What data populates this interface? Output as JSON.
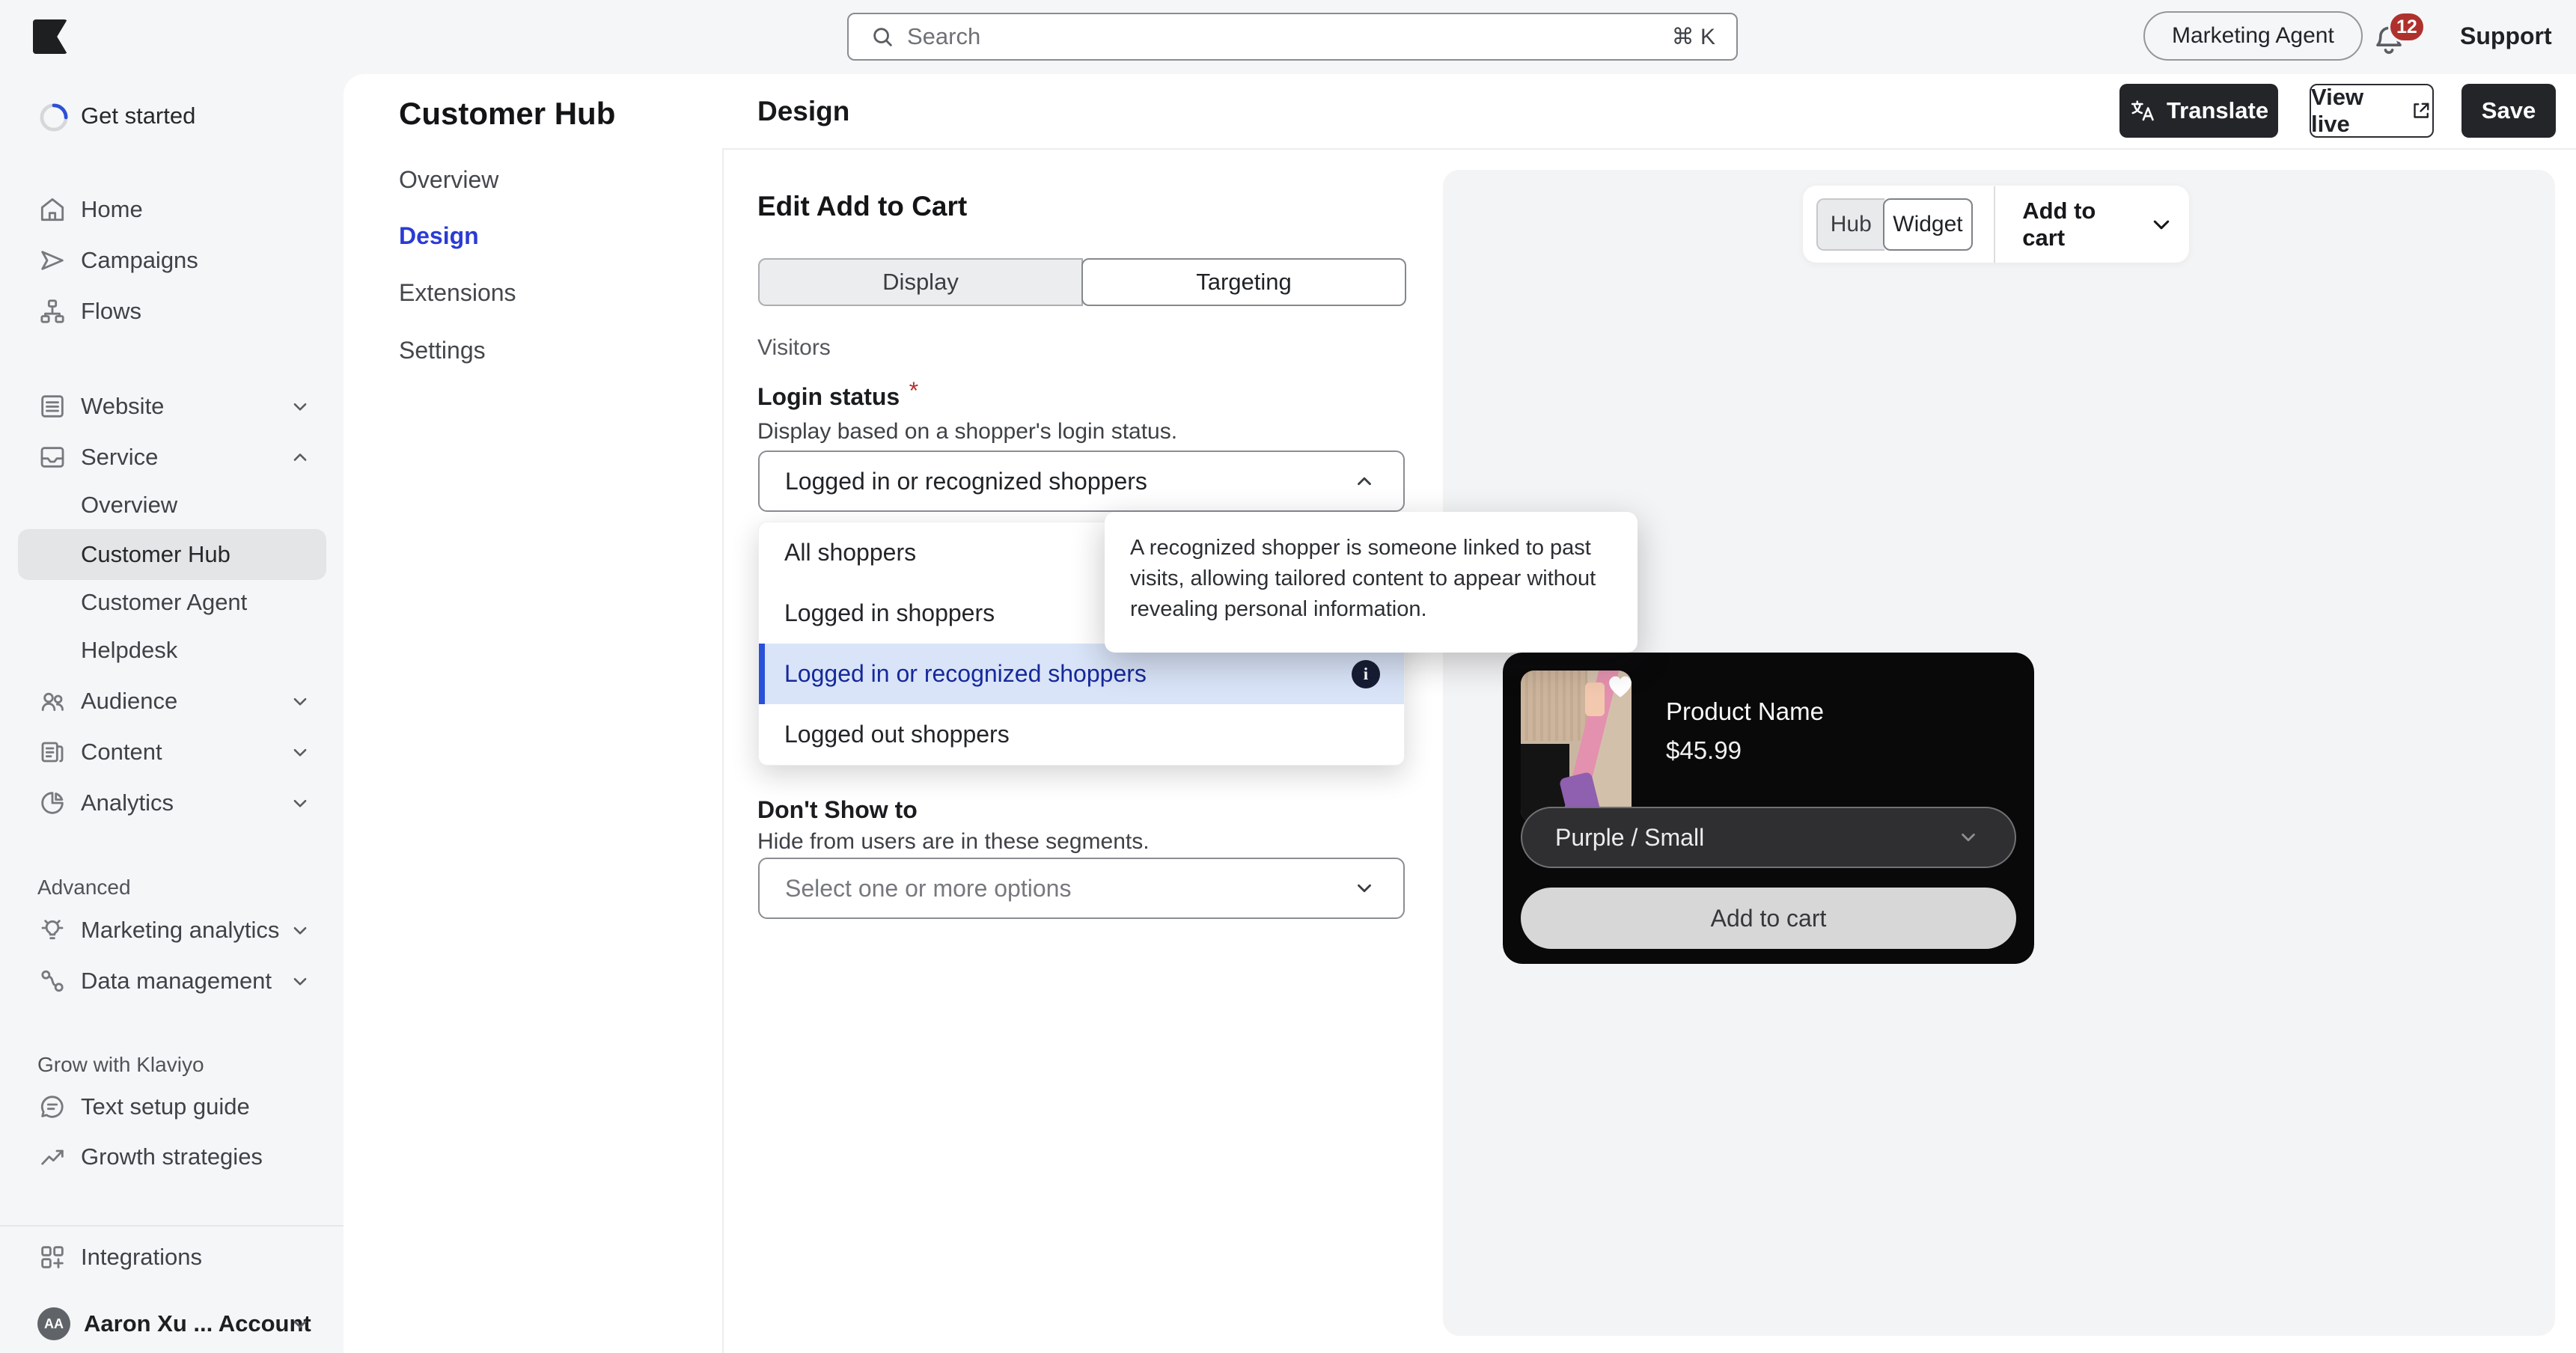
{
  "topbar": {
    "search_placeholder": "Search",
    "search_shortcut": "⌘ K",
    "marketing_agent": "Marketing Agent",
    "notification_count": "12",
    "support": "Support"
  },
  "sidebar": {
    "get_started": "Get started",
    "home": "Home",
    "campaigns": "Campaigns",
    "flows": "Flows",
    "website": "Website",
    "service": "Service",
    "overview": "Overview",
    "customer_hub": "Customer Hub",
    "customer_agent": "Customer Agent",
    "helpdesk": "Helpdesk",
    "audience": "Audience",
    "content": "Content",
    "analytics": "Analytics",
    "advanced_label": "Advanced",
    "marketing_analytics": "Marketing analytics",
    "data_management": "Data management",
    "grow_label": "Grow with Klaviyo",
    "text_setup_guide": "Text setup guide",
    "growth_strategies": "Growth strategies",
    "integrations": "Integrations",
    "account": {
      "initials": "AA",
      "name": "Aaron Xu ... Account"
    }
  },
  "subnav": {
    "title": "Customer Hub",
    "overview": "Overview",
    "design": "Design",
    "extensions": "Extensions",
    "settings": "Settings"
  },
  "header": {
    "title": "Design",
    "translate": "Translate",
    "view_live": "View live",
    "save": "Save"
  },
  "panel": {
    "title": "Edit Add to Cart",
    "tab_display": "Display",
    "tab_targeting": "Targeting",
    "visitors": "Visitors",
    "login_label": "Login status",
    "required_mark": "*",
    "login_helper": "Display based on a shopper's login status.",
    "login_value": "Logged in or recognized shoppers",
    "options": [
      "All shoppers",
      "Logged in shoppers",
      "Logged in or recognized shoppers",
      "Logged out shoppers"
    ],
    "selected_option_index": 2,
    "info_glyph": "i",
    "tooltip": "A recognized shopper is someone linked to past visits, allowing tailored content to appear without revealing personal information.",
    "dont_show_label": "Don't Show to",
    "dont_show_helper": "Hide from users are in these segments.",
    "dont_show_placeholder": "Select one or more options"
  },
  "preview": {
    "hub": "Hub",
    "widget": "Widget",
    "context": "Add to cart",
    "product": {
      "name": "Product Name",
      "price": "$45.99",
      "variant": "Purple / Small",
      "add_to_cart": "Add to cart"
    }
  },
  "colors": {
    "accent_blue": "#2B3BD4",
    "selected_option_bg": "#D9E4F8",
    "selected_option_bar": "#2B50D8",
    "selected_option_text": "#16289B",
    "badge_red": "#AF312D",
    "dark_button": "#232529",
    "card_black": "#09090A",
    "page_bg": "#F5F6F7"
  }
}
